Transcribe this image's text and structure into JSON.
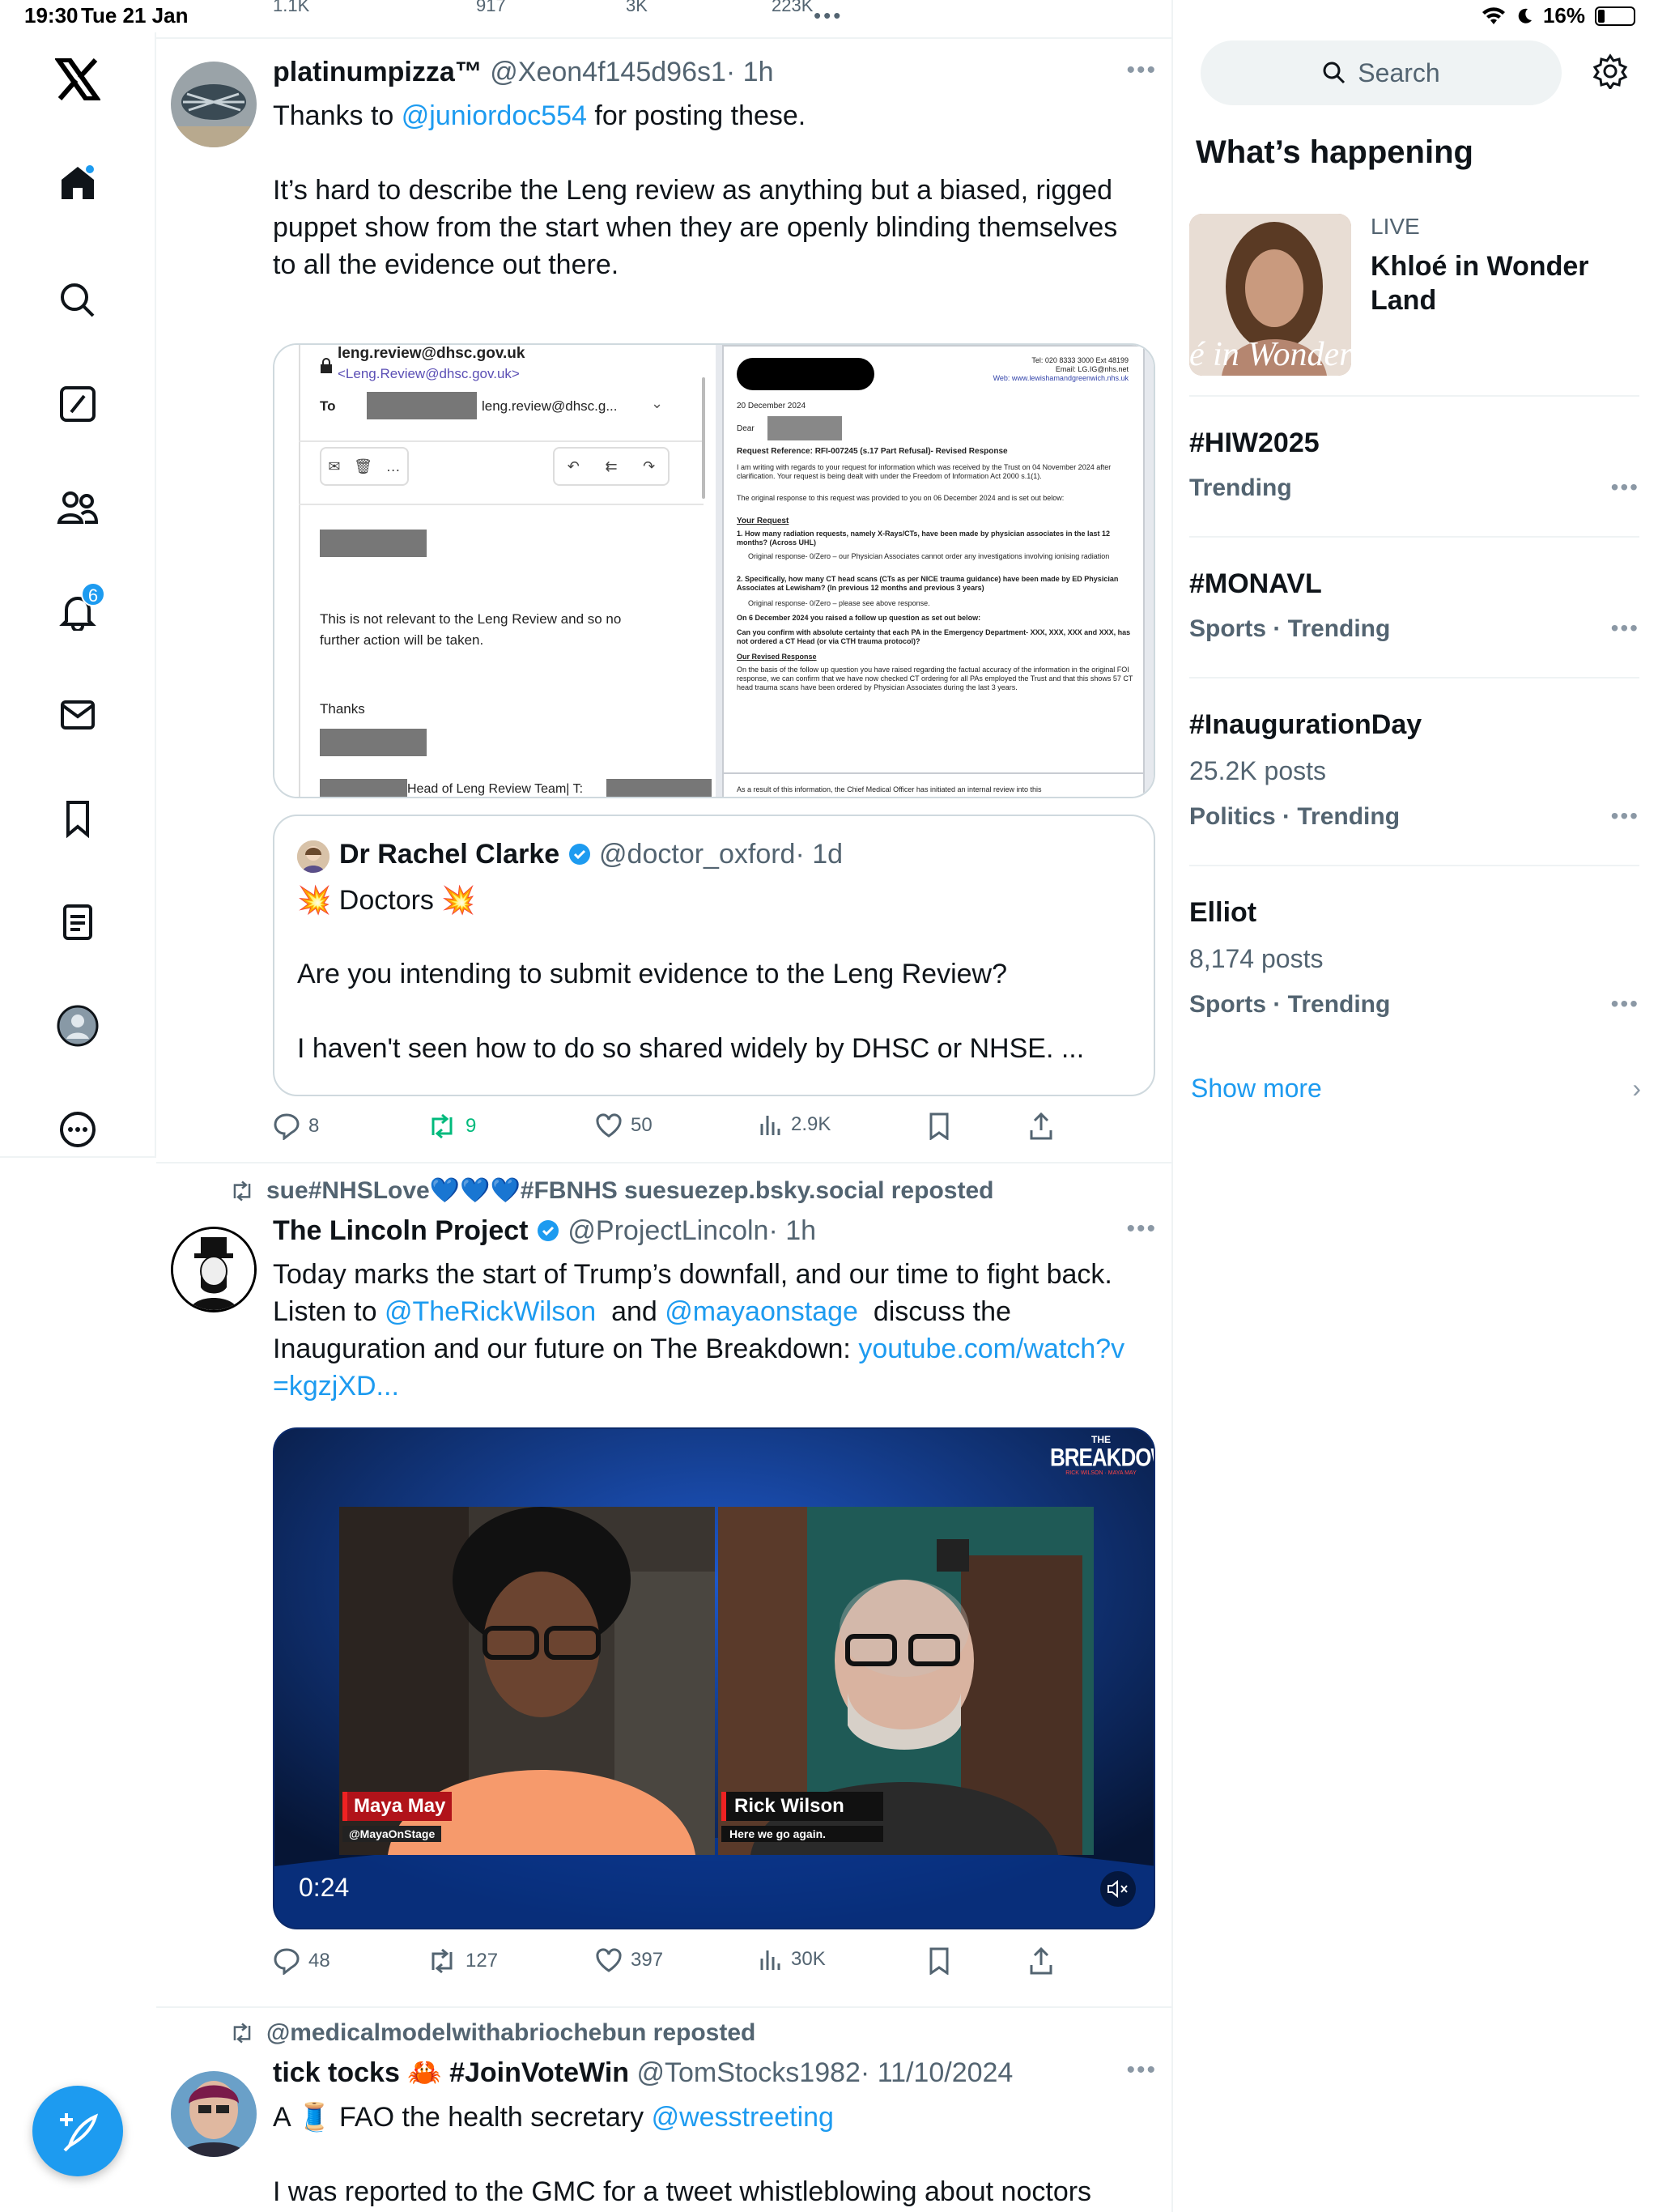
{
  "status_bar": {
    "time": "19:30",
    "date": "Tue 21 Jan",
    "battery": "16%"
  },
  "nav": {
    "items": [
      "home",
      "explore",
      "grok",
      "communities",
      "notifications",
      "messages",
      "bookmarks",
      "lists",
      "profile",
      "more"
    ],
    "notifications_badge": "6"
  },
  "top_partial": {
    "replies": "1.1K",
    "reposts": "917",
    "likes": "3K",
    "views": "223K"
  },
  "tweet1": {
    "name": "platinumpizza™",
    "handle": "@Xeon4f145d96s1",
    "time": "· 1h",
    "text_a": "Thanks to ",
    "mention": "@juniordoc554",
    "text_b": " for posting these.",
    "para2": "It’s hard to describe the Leng review as anything but a biased, rigged puppet show from the start when they are openly blinding themselves to all the evidence out there.",
    "email": {
      "from": "leng.review@dhsc.gov.uk",
      "from_angle": "<Leng.Review@dhsc.gov.uk>",
      "to_label": "To",
      "to_value": "leng.review@dhsc.g...",
      "body": "This is not relevant to the Leng Review and so no further action will be taken.",
      "thanks": "Thanks",
      "sig": "Head of Leng Review Team| T:"
    },
    "letter": {
      "tel": "Tel: 020 8333 3000 Ext 48199",
      "email": "Email: LG.IG@nhs.net",
      "web": "Web: www.lewishamandgreenwich.nhs.uk",
      "date": "20 December 2024",
      "dear": "Dear",
      "ref": "Request Reference: RFI-007245 (s.17 Part Refusal)- Revised Response",
      "p1": "I am writing with regards to your request for information which was received by the Trust on 04 November 2024 after clarification. Your request is being dealt with under the Freedom of Information Act 2000 s.1(1).",
      "p2": "The original response to this request was provided to you on 06 December 2024 and is set out below:",
      "your_request": "Your Request",
      "q1": "1. How many radiation requests, namely X-Rays/CTs, have been made by physician associates in the last 12 months? (Across UHL)",
      "a1": "Original response- 0/Zero – our Physician Associates cannot order any investigations involving ionising radiation",
      "q2": "2. Specifically, how many CT head scans (CTs as per NICE trauma guidance) have been made by ED Physician Associates at Lewisham? (In previous 12 months and previous 3 years)",
      "a2": "Original response- 0/Zero – please see above response.",
      "followup": "On 6 December 2024 you raised a follow up question as set out below:",
      "fq": "Can you confirm with absolute certainty that each PA in the Emergency Department- XXX, XXX, XXX and XXX, has not ordered a CT Head (or via CTH trauma protocol)?",
      "revised": "Our Revised Response",
      "rp": "On the basis of the follow up question you have raised regarding the factual accuracy of the information in the original FOI response, we can confirm that we have now checked CT ordering for all PAs employed the Trust and that this shows 57 CT head trauma scans have been ordered by Physician Associates during the last 3 years.",
      "p_bottom": "As a result of this information, the Chief Medical Officer has initiated an internal review into this"
    },
    "quote": {
      "name": "Dr Rachel Clarke",
      "handle": "@doctor_oxford",
      "time": "· 1d",
      "line1_emoji": "💥",
      "line1": " Doctors ",
      "line2": "Are you intending to submit evidence to the Leng Review?",
      "line3": "I haven't seen how to do so shared widely by DHSC or NHSE. ..."
    },
    "actions": {
      "replies": "8",
      "reposts": "9",
      "likes": "50",
      "views": "2.9K"
    }
  },
  "tweet2": {
    "repost_by": "sue#NHSLove💙💙💙#FBNHS suesuezep.bsky.social reposted",
    "name": "The Lincoln Project",
    "handle": "@ProjectLincoln",
    "time": "· 1h",
    "t1": "Today marks the start of Trump’s downfall, and our time to fight back. Listen to ",
    "m1": "@TheRickWilson",
    "t2": "  and ",
    "m2": "@mayaonstage",
    "t3": "  discuss the Inauguration and our future on The Breakdown: ",
    "url": "youtube.com/watch?v=kgzjXD...",
    "video": {
      "logo_top": "THE",
      "logo": "BREAKDOWN",
      "logo_sub": "RICK WILSON · MAYA MAY",
      "left_name": "Maya May",
      "left_sub": "@MayaOnStage",
      "right_name": "Rick Wilson",
      "right_sub": "Here we go again.",
      "duration": "0:24"
    },
    "actions": {
      "replies": "48",
      "reposts": "127",
      "likes": "397",
      "views": "30K"
    }
  },
  "tweet3": {
    "repost_by": "@medicalmodelwithabriochebun reposted",
    "name": "tick tocks 🦀 #JoinVoteWin",
    "handle": "@TomStocks1982",
    "time": "· 11/10/2024",
    "t1": "A 🧵 FAO the health secretary ",
    "m1": "@wesstreeting",
    "t2": "I was reported to the GMC for a tweet whistleblowing about noctors"
  },
  "sidebar": {
    "search_placeholder": "Search",
    "heading": "What’s happening",
    "live": {
      "label": "LIVE",
      "title": "Khloé in Wonder Land",
      "thumb_text": "é in Wonder l"
    },
    "trends": [
      {
        "name": "#HIW2025",
        "meta": "Trending"
      },
      {
        "name": "#MONAVL",
        "meta": "Sports · Trending"
      },
      {
        "name": "#InaugurationDay",
        "count": "25.2K posts",
        "meta": "Politics · Trending"
      },
      {
        "name": "Elliot",
        "count": "8,174 posts",
        "meta": "Sports · Trending"
      }
    ],
    "show_more": "Show more"
  },
  "colors": {
    "accent": "#1d9bf0",
    "repost_green": "#00ba7c",
    "text": "#0f1419",
    "muted": "#536471"
  }
}
